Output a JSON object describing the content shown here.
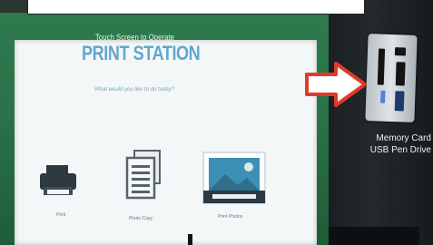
{
  "kiosk": {
    "bezel_caption": "Touch Screen to Operate",
    "screen_title": "PRINT STATION",
    "screen_subtitle": "What would you like to do today?",
    "options": [
      {
        "label": "Print",
        "icon": "printer-icon"
      },
      {
        "label": "Photo Copy",
        "icon": "documents-icon"
      },
      {
        "label": "Print Photos",
        "icon": "photo-icon"
      }
    ]
  },
  "side_panel": {
    "slot_caption_line1": "Memory Card",
    "slot_caption_line2": "USB Pen Drive",
    "arrow_color": "#e23a2a"
  },
  "colors": {
    "bezel": "#2a7247",
    "title": "#5ea8cc"
  }
}
